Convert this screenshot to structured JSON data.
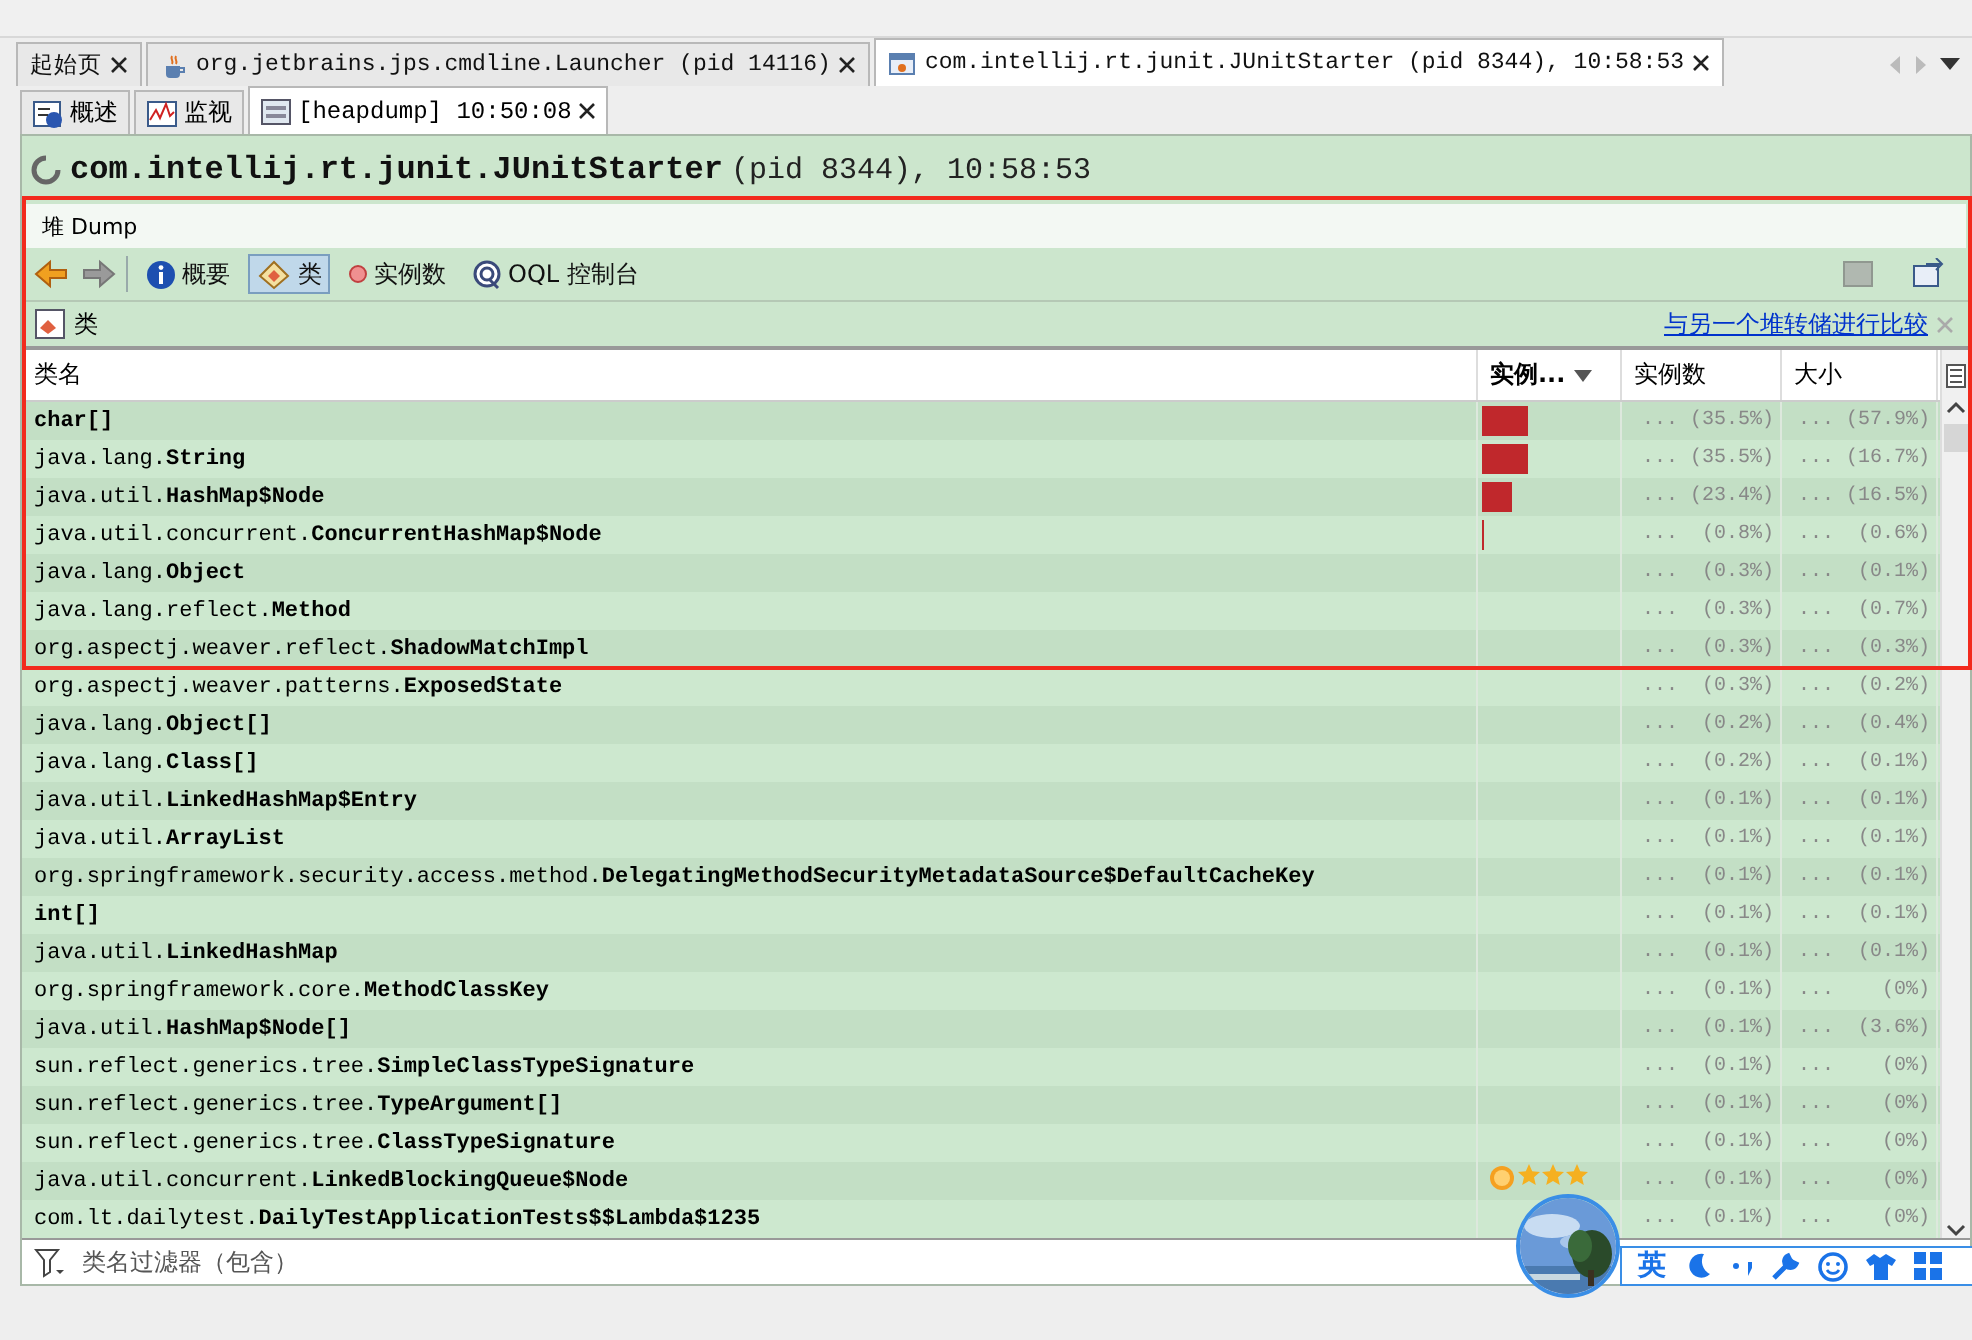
{
  "top_tabs": [
    {
      "label": "起始页",
      "selected": false
    },
    {
      "label": "org.jetbrains.jps.cmdline.Launcher (pid 14116)",
      "selected": false
    },
    {
      "label": "com.intellij.rt.junit.JUnitStarter (pid 8344), 10:58:53",
      "selected": true
    }
  ],
  "sub_tabs": [
    {
      "label": "概述",
      "closable": false,
      "selected": false
    },
    {
      "label": "监视",
      "closable": false,
      "selected": false
    },
    {
      "label": "[heapdump] 10:50:08",
      "closable": true,
      "selected": true
    }
  ],
  "title": {
    "name": "com.intellij.rt.junit.JUnitStarter",
    "info": "(pid 8344), 10:58:53"
  },
  "panel_title": "堆 Dump",
  "nav": {
    "back_disabled": false,
    "forward_disabled": true
  },
  "views": [
    {
      "label": "概要",
      "selected": false
    },
    {
      "label": "类",
      "selected": true
    },
    {
      "label": "实例数",
      "selected": false
    },
    {
      "label": "OQL 控制台",
      "selected": false
    }
  ],
  "section": {
    "label": "类",
    "link": "与另一个堆转储进行比较"
  },
  "table": {
    "columns": [
      {
        "label": "类名",
        "sorted": false
      },
      {
        "label": "实例...",
        "sorted": true
      },
      {
        "label": "实例数",
        "sorted": false
      },
      {
        "label": "大小",
        "sorted": false
      }
    ],
    "rows": [
      {
        "pkg": "",
        "cls": "char[]",
        "level": 0.355,
        "instances": "... (35.5%)",
        "size": "... (57.9%)"
      },
      {
        "pkg": "java.lang.",
        "cls": "String",
        "level": 0.355,
        "instances": "... (35.5%)",
        "size": "... (16.7%)"
      },
      {
        "pkg": "java.util.",
        "cls": "HashMap$Node",
        "level": 0.234,
        "instances": "... (23.4%)",
        "size": "... (16.5%)"
      },
      {
        "pkg": "java.util.concurrent.",
        "cls": "ConcurrentHashMap$Node",
        "level": 0.008,
        "instances": "...  (0.8%)",
        "size": "...  (0.6%)"
      },
      {
        "pkg": "java.lang.",
        "cls": "Object",
        "instances": "...  (0.3%)",
        "size": "...  (0.1%)"
      },
      {
        "pkg": "java.lang.reflect.",
        "cls": "Method",
        "instances": "...  (0.3%)",
        "size": "...  (0.7%)"
      },
      {
        "pkg": "org.aspectj.weaver.reflect.",
        "cls": "ShadowMatchImpl",
        "instances": "...  (0.3%)",
        "size": "...  (0.3%)"
      },
      {
        "pkg": "org.aspectj.weaver.patterns.",
        "cls": "ExposedState",
        "instances": "...  (0.3%)",
        "size": "...  (0.2%)"
      },
      {
        "pkg": "java.lang.",
        "cls": "Object[]",
        "instances": "...  (0.2%)",
        "size": "...  (0.4%)"
      },
      {
        "pkg": "java.lang.",
        "cls": "Class[]",
        "instances": "...  (0.2%)",
        "size": "...  (0.1%)"
      },
      {
        "pkg": "java.util.",
        "cls": "LinkedHashMap$Entry",
        "instances": "...  (0.1%)",
        "size": "...  (0.1%)"
      },
      {
        "pkg": "java.util.",
        "cls": "ArrayList",
        "instances": "...  (0.1%)",
        "size": "...  (0.1%)"
      },
      {
        "pkg": "org.springframework.security.access.method.",
        "cls": "DelegatingMethodSecurityMetadataSource$DefaultCacheKey",
        "instances": "...  (0.1%)",
        "size": "...  (0.1%)"
      },
      {
        "pkg": "",
        "cls": "int[]",
        "instances": "...  (0.1%)",
        "size": "...  (0.1%)"
      },
      {
        "pkg": "java.util.",
        "cls": "LinkedHashMap",
        "instances": "...  (0.1%)",
        "size": "...  (0.1%)"
      },
      {
        "pkg": "org.springframework.core.",
        "cls": "MethodClassKey",
        "instances": "...  (0.1%)",
        "size": "...    (0%)"
      },
      {
        "pkg": "java.util.",
        "cls": "HashMap$Node[]",
        "instances": "...  (0.1%)",
        "size": "...  (3.6%)"
      },
      {
        "pkg": "sun.reflect.generics.tree.",
        "cls": "SimpleClassTypeSignature",
        "instances": "...  (0.1%)",
        "size": "...    (0%)"
      },
      {
        "pkg": "sun.reflect.generics.tree.",
        "cls": "TypeArgument[]",
        "instances": "...  (0.1%)",
        "size": "...    (0%)"
      },
      {
        "pkg": "sun.reflect.generics.tree.",
        "cls": "ClassTypeSignature",
        "instances": "...  (0.1%)",
        "size": "...    (0%)"
      },
      {
        "pkg": "java.util.concurrent.",
        "cls": "LinkedBlockingQueue$Node",
        "instances": "...  (0.1%)",
        "size": "...    (0%)"
      },
      {
        "pkg": "com.lt.dailytest.",
        "cls": "DailyTestApplicationTests$$Lambda$1235",
        "instances": "...  (0.1%)",
        "size": "...    (0%)"
      }
    ]
  },
  "filter": {
    "placeholder": "类名过滤器（包含）"
  },
  "ime": {
    "label": "英"
  },
  "annotation": {
    "kind": "rectangle"
  }
}
